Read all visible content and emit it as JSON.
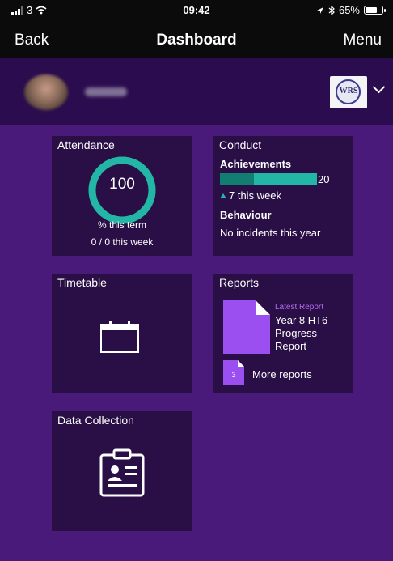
{
  "status_bar": {
    "carrier": "3",
    "time": "09:42",
    "battery": "65%"
  },
  "nav": {
    "back": "Back",
    "title": "Dashboard",
    "menu": "Menu"
  },
  "profile": {
    "school_logo_text": "WRS"
  },
  "tiles": {
    "attendance": {
      "title": "Attendance",
      "value": "100",
      "percent": 100,
      "line1": "% this term",
      "line2": "0 / 0 this week"
    },
    "conduct": {
      "title": "Conduct",
      "achievements_label": "Achievements",
      "achievements_total": "20",
      "achievements_week_share": 0.35,
      "achievements_week": "7 this week",
      "behaviour_label": "Behaviour",
      "behaviour_text": "No incidents this year"
    },
    "timetable": {
      "title": "Timetable"
    },
    "reports": {
      "title": "Reports",
      "latest_label": "Latest Report",
      "latest_name": "Year 8 HT6 Progress Report",
      "more_count": "3",
      "more_label": "More reports"
    },
    "data_collection": {
      "title": "Data Collection"
    }
  },
  "colors": {
    "background": "#4a1a7a",
    "tile": "#2a0f46",
    "accent_green": "#23b5a5",
    "accent_purple": "#9b4ff0"
  }
}
